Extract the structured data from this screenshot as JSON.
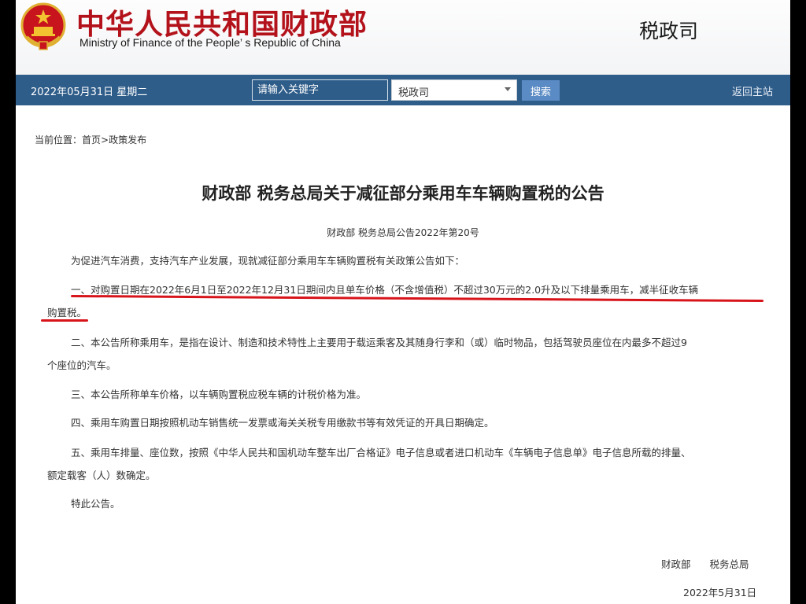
{
  "header": {
    "title_cn": "中华人民共和国财政部",
    "title_en": "Ministry of Finance of the People’ s Republic of China",
    "department": "税政司",
    "brand_red": "#b3121b"
  },
  "navbar": {
    "date": "2022年05月31日  星期二",
    "search_placeholder": "请输入关键字",
    "select_value": "税政司",
    "search_button": "搜索",
    "home_link": "返回主站",
    "bg_color": "#2f5d8a"
  },
  "breadcrumb": {
    "label": "当前位置：",
    "home": "首页",
    "sep": ">",
    "current": "政策发布"
  },
  "article": {
    "title": "财政部 税务总局关于减征部分乘用车车辆购置税的公告",
    "doc_number": "财政部 税务总局公告2022年第20号",
    "intro": "为促进汽车消费，支持汽车产业发展，现就减征部分乘用车车辆购置税有关政策公告如下：",
    "p1_line1": "一、对购置日期在2022年6月1日至2022年12月31日期间内且单车价格（不含增值税）不超过30万元的2.0升及以下排量乘用车，减半征收车辆",
    "p1_line2": "购置税。",
    "p2_line1": "二、本公告所称乘用车，是指在设计、制造和技术特性上主要用于载运乘客及其随身行李和（或）临时物品，包括驾驶员座位在内最多不超过9",
    "p2_line2": "个座位的汽车。",
    "p3": "三、本公告所称单车价格，以车辆购置税应税车辆的计税价格为准。",
    "p4": "四、乘用车购置日期按照机动车销售统一发票或海关关税专用缴款书等有效凭证的开具日期确定。",
    "p5_line1": "五、乘用车排量、座位数，按照《中华人民共和国机动车整车出厂合格证》电子信息或者进口机动车《车辆电子信息单》电子信息所载的排量、",
    "p5_line2": "额定载客（人）数确定。",
    "closing": "特此公告。",
    "signers": "财政部 税务总局",
    "sign_date": "2022年5月31日"
  },
  "annotation": {
    "underline_color": "#d8141b"
  }
}
